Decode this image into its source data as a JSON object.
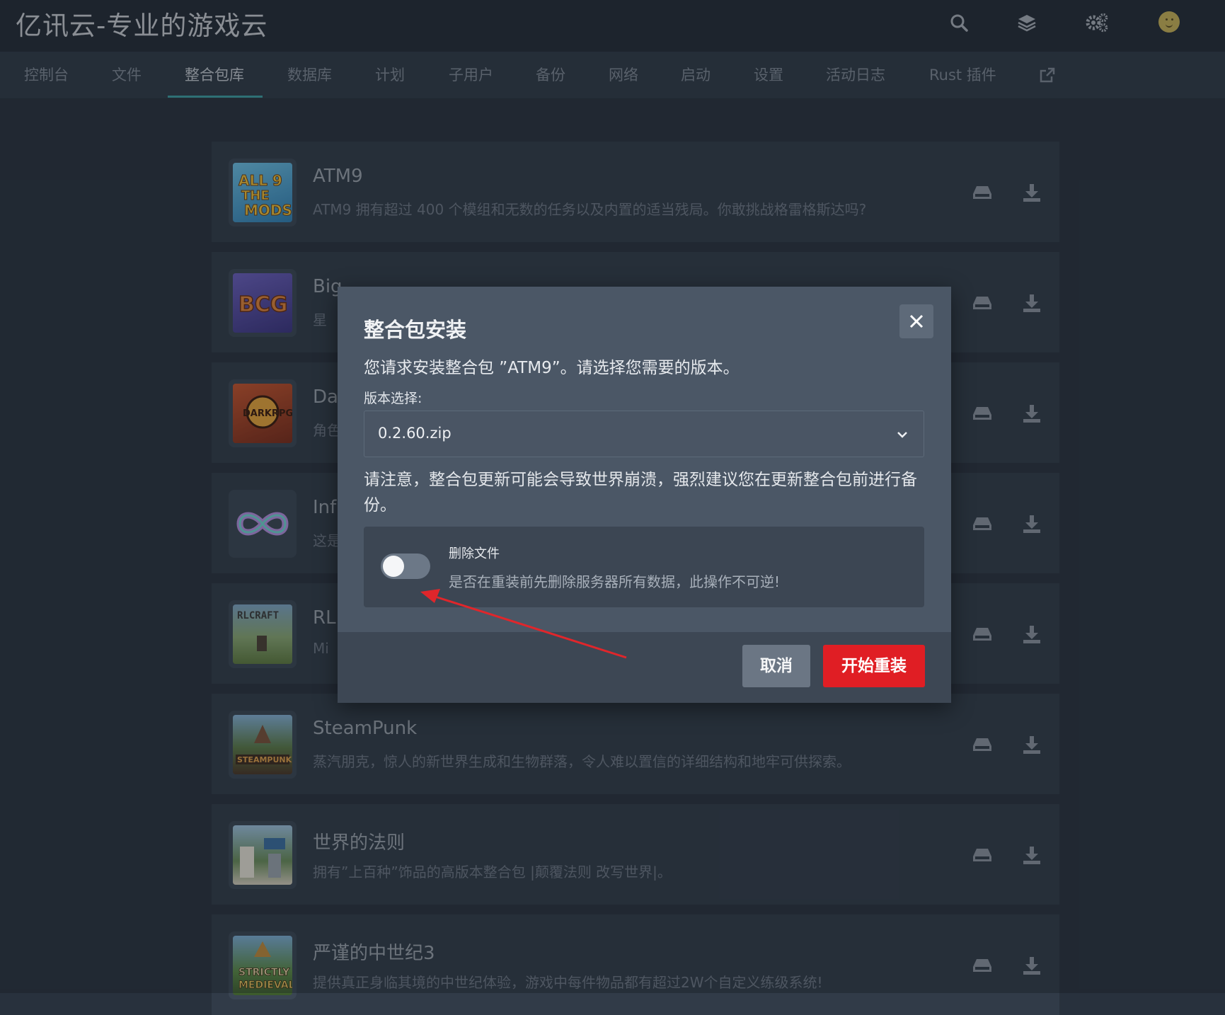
{
  "header": {
    "title": "亿讯云-专业的游戏云",
    "icons": [
      "search-icon",
      "layers-icon",
      "settings-icon",
      "avatar"
    ]
  },
  "nav": {
    "tabs": [
      {
        "label": "控制台"
      },
      {
        "label": "文件"
      },
      {
        "label": "整合包库",
        "active": true
      },
      {
        "label": "数据库"
      },
      {
        "label": "计划"
      },
      {
        "label": "子用户"
      },
      {
        "label": "备份"
      },
      {
        "label": "网络"
      },
      {
        "label": "启动"
      },
      {
        "label": "设置"
      },
      {
        "label": "活动日志"
      },
      {
        "label": "Rust 插件"
      }
    ],
    "external_icon": "external-link-icon"
  },
  "packs": [
    {
      "name": "ATM9",
      "desc": "ATM9 拥有超过 400 个模组和无数的任务以及内置的适当残局。你敢挑战格雷格斯达吗?"
    },
    {
      "name": "Big",
      "desc": "星"
    },
    {
      "name": "Da",
      "desc": "角色"
    },
    {
      "name": "Inf",
      "desc": "这是"
    },
    {
      "name": "RL",
      "desc": "Mi"
    },
    {
      "name": "SteamPunk",
      "desc": "蒸汽朋克，惊人的新世界生成和生物群落，令人难以置信的详细结构和地牢可供探索。"
    },
    {
      "name": "世界的法则",
      "desc": "拥有”上百种”饰品的高版本整合包 |颠覆法则 改写世界|。"
    },
    {
      "name": "严谨的中世纪3",
      "desc": "提供真正身临其境的中世纪体验，游戏中每件物品都有超过2W个自定义练级系统!"
    }
  ],
  "modal": {
    "title": "整合包安装",
    "subtitle": "您请求安装整合包 ”ATM9”。请选择您需要的版本。",
    "version_label": "版本选择:",
    "version_value": "0.2.60.zip",
    "warning": "请注意，整合包更新可能会导致世界崩溃，强烈建议您在更新整合包前进行备份。",
    "delete_title": "删除文件",
    "delete_desc": "是否在重装前先删除服务器所有数据，此操作不可逆!",
    "delete_enabled": false,
    "cancel_label": "取消",
    "confirm_label": "开始重装",
    "accent_color": "#e01e24"
  }
}
